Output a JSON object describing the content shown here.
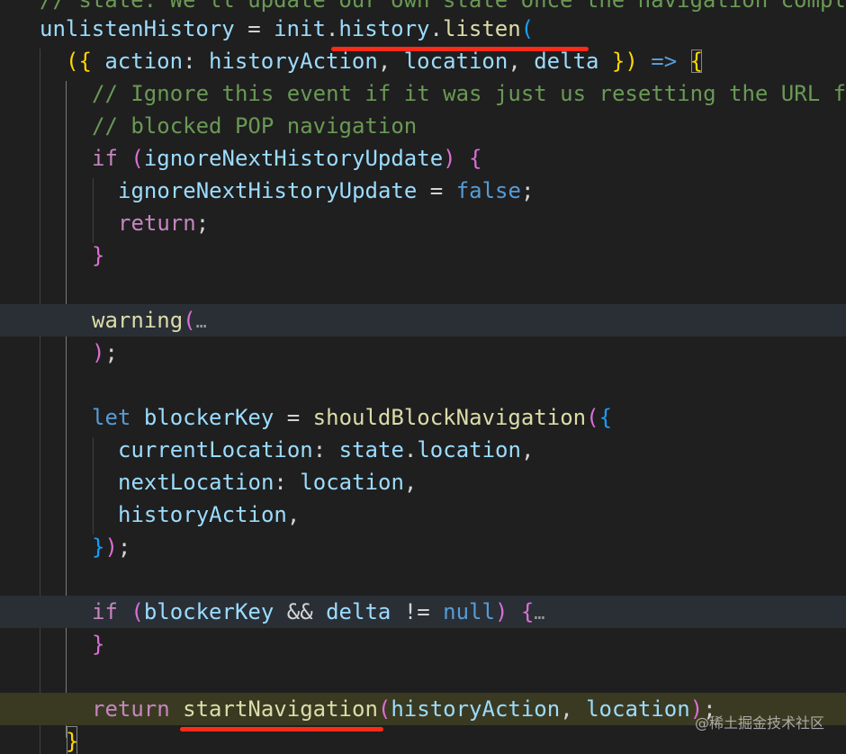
{
  "code": {
    "line0": "// state. We'll update our own state once the navigation completes",
    "line1": {
      "name": "unlistenHistory",
      "eq": " = ",
      "obj": "init",
      "dot1": ".",
      "prop": "history",
      "dot2": ".",
      "fn": "listen",
      "paren": "("
    },
    "line2": {
      "open": "({",
      "param1": "action",
      "colon": ": ",
      "param1_alias": "historyAction",
      "comma1": ", ",
      "param2": "location",
      "comma2": ", ",
      "param3": "delta",
      "close": " })",
      "arrow": " => ",
      "brace": "{"
    },
    "line3": "// Ignore this event if it was just us resetting the URL from a",
    "line4": "// blocked POP navigation",
    "line5": {
      "kw": "if",
      "space": " ",
      "open": "(",
      "cond": "ignoreNextHistoryUpdate",
      "close": ")",
      "brace": " {"
    },
    "line6": {
      "name": "ignoreNextHistoryUpdate",
      "eq": " = ",
      "val": "false",
      "semi": ";"
    },
    "line7": {
      "kw": "return",
      "semi": ";"
    },
    "line8": "}",
    "line10": {
      "fn": "warning",
      "paren": "(",
      "fold": "…"
    },
    "line11": {
      "paren": ")",
      "semi": ";"
    },
    "line13": {
      "kw": "let",
      "name": "blockerKey",
      "eq": " = ",
      "fn": "shouldBlockNavigation",
      "paren": "(",
      "brace": "{"
    },
    "line14": {
      "key": "currentLocation",
      "colon": ": ",
      "obj": "state",
      "dot": ".",
      "prop": "location",
      "comma": ","
    },
    "line15": {
      "key": "nextLocation",
      "colon": ": ",
      "val": "location",
      "comma": ","
    },
    "line16": {
      "key": "historyAction",
      "comma": ","
    },
    "line17": {
      "brace": "}",
      "paren": ")",
      "semi": ";"
    },
    "line19": {
      "kw": "if",
      "open": " (",
      "a": "blockerKey",
      "and": " && ",
      "b": "delta",
      "neq": " != ",
      "null": "null",
      "close": ")",
      "brace": " {",
      "fold": "…"
    },
    "line20": "}",
    "line22": {
      "kw": "return",
      "fn": "startNavigation",
      "open": "(",
      "a": "historyAction",
      "comma": ", ",
      "b": "location",
      "close": ")",
      "semi": ";"
    },
    "line23": "}"
  },
  "watermark": "@稀土掘金技术社区",
  "colors": {
    "background": "#1f1f1f",
    "comment": "#6a9955",
    "variable": "#9cdcfe",
    "function": "#dcdcaa",
    "keyword_control": "#c586c0",
    "keyword_storage": "#569cd6",
    "annotation_red": "#ff2a17"
  }
}
